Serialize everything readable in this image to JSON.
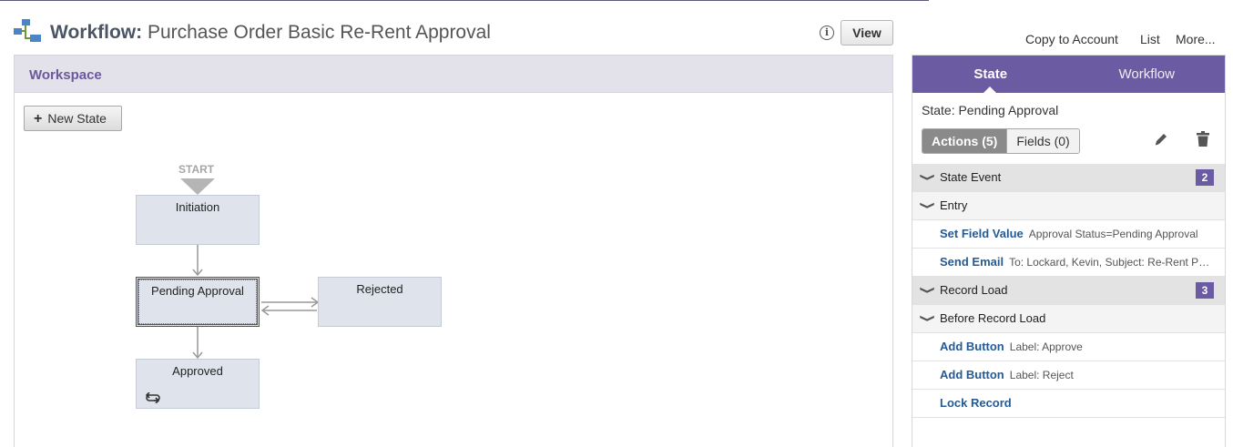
{
  "header": {
    "title_prefix": "Workflow:",
    "title_name": "Purchase Order Basic Re-Rent Approval",
    "view_label": "View",
    "info_icon": "info-icon",
    "links": [
      "Copy to Account",
      "List",
      "More..."
    ]
  },
  "workspace": {
    "title": "Workspace",
    "new_state_label": "New State",
    "start_label": "START",
    "states": [
      {
        "label": "Initiation"
      },
      {
        "label": "Pending Approval",
        "selected": true
      },
      {
        "label": "Rejected"
      },
      {
        "label": "Approved",
        "icon": "loop-icon"
      }
    ]
  },
  "panel": {
    "tabs": [
      "State",
      "Workflow"
    ],
    "active_tab": "State",
    "state_label": "State: Pending Approval",
    "segments": [
      "Actions (5)",
      "Fields (0)"
    ],
    "groups": [
      {
        "name": "State Event",
        "count": "2",
        "subgroups": [
          {
            "name": "Entry",
            "actions": [
              {
                "name": "Set Field Value",
                "detail": "Approval Status=Pending Approval"
              },
              {
                "name": "Send Email",
                "detail": "To: Lockard, Kevin, Subject: Re-Rent Pu..."
              }
            ]
          }
        ]
      },
      {
        "name": "Record Load",
        "count": "3",
        "subgroups": [
          {
            "name": "Before Record Load",
            "actions": [
              {
                "name": "Add Button",
                "detail": "Label: Approve"
              },
              {
                "name": "Add Button",
                "detail": "Label: Reject"
              },
              {
                "name": "Lock Record",
                "detail": ""
              }
            ]
          }
        ]
      }
    ]
  },
  "colors": {
    "accent": "#6b5ba2",
    "link": "#255a94",
    "state_fill": "#dfe4ec"
  }
}
